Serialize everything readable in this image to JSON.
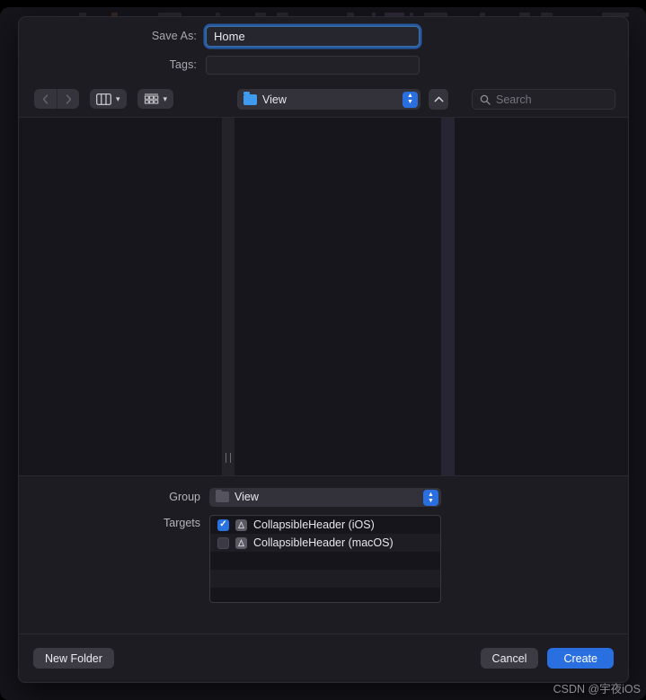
{
  "dialog": {
    "save_as_label": "Save As:",
    "save_as_value": "Home",
    "tags_label": "Tags:",
    "tags_value": "",
    "accent_color": "#2a6fe0"
  },
  "toolbar": {
    "back_icon": "chevron-left-icon",
    "forward_icon": "chevron-right-icon",
    "view_mode_icon": "column-view-icon",
    "arrange_icon": "group-view-icon",
    "path_folder_icon": "folder-icon",
    "path_value": "View",
    "stepper_up": "▲",
    "stepper_down": "▼",
    "expand_icon": "chevron-up-icon",
    "search_icon": "search-icon",
    "search_placeholder": "Search",
    "search_value": ""
  },
  "browser": {
    "columns": [
      "",
      "",
      ""
    ],
    "resize_grip": "column-resize-grip"
  },
  "group": {
    "label": "Group",
    "folder_icon": "folder-icon",
    "value": "View"
  },
  "targets": {
    "label": "Targets",
    "items": [
      {
        "name": "CollapsibleHeader (iOS)",
        "checked": true,
        "icon": "app-icon"
      },
      {
        "name": "CollapsibleHeader (macOS)",
        "checked": false,
        "icon": "app-icon"
      }
    ]
  },
  "footer": {
    "new_folder_label": "New Folder",
    "cancel_label": "Cancel",
    "create_label": "Create"
  },
  "watermark": {
    "text": "CSDN @宇夜iOS"
  }
}
